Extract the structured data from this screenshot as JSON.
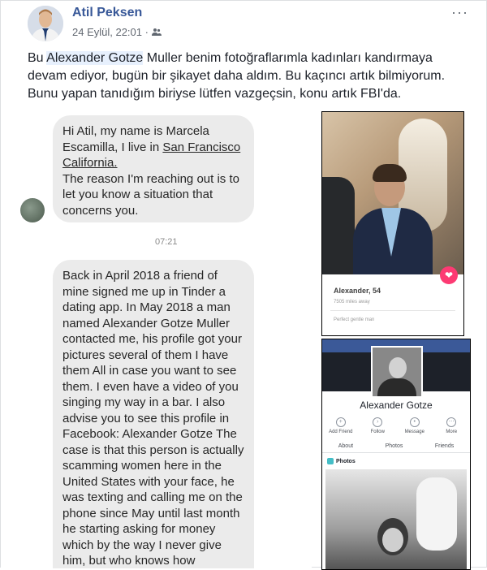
{
  "post": {
    "author": "Atil Peksen",
    "date": "24 Eylül, 22:01 ·",
    "audience_icon": "friends-icon",
    "more_icon": "more-dots-icon",
    "text_before": "Bu ",
    "text_highlight": "Alexander Gotze",
    "text_after": " Muller benim fotoğraflarımla kadınları kandırmaya devam ediyor, bugün bir şikayet daha aldım. Bu kaçıncı artık bilmiyorum. Bunu yapan tanıdığım biriyse lütfen vazgeçsin, konu artık FBI'da."
  },
  "chat": {
    "message1_a": "Hi Atil, my name is Marcela Escamilla, I live in ",
    "message1_link": "San Francisco California.",
    "message1_b": "The reason I'm reaching out is to let you know a situation that concerns you.",
    "timestamp": "07:21",
    "message2": "Back in April 2018 a friend of mine signed me up in Tinder a dating app. In May 2018 a man named Alexander Gotze Muller contacted me, his profile got your pictures several of them I have them All in case you want to see them. I even have a video of you singing my way in a bar. I also advise you to see this profile in Facebook: Alexander Gotze The case is that this person is actually scamming women here in the United States with your face, he was texting and calling me on the phone since May until last month he starting asking for money which by the way I never give him, but who knows how"
  },
  "dating_profile": {
    "name": "Alexander, 54",
    "distance": "7505 miles away",
    "bio": "Perfect gentle man"
  },
  "fb_profile": {
    "name": "Alexander Gotze",
    "actions": [
      "Add Friend",
      "Follow",
      "Message",
      "More"
    ],
    "tabs": [
      "About",
      "Photos",
      "Friends"
    ],
    "photos_header": "Photos"
  }
}
